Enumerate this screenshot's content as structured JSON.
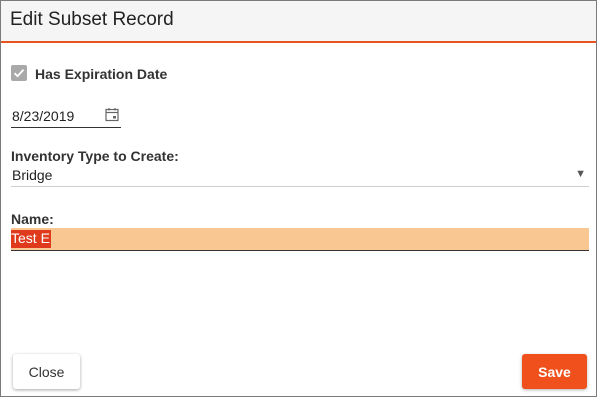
{
  "dialog": {
    "title": "Edit Subset Record"
  },
  "expiration": {
    "checkbox_label": "Has Expiration Date",
    "checked": true,
    "date_value": "8/23/2019"
  },
  "inventory_type": {
    "label": "Inventory Type to Create:",
    "selected": "Bridge"
  },
  "name": {
    "label": "Name:",
    "value": "Test E"
  },
  "buttons": {
    "close_label": "Close",
    "save_label": "Save"
  },
  "icons": {
    "check": "check-icon",
    "calendar": "calendar-icon",
    "dropdown": "dropdown-arrow-icon"
  },
  "colors": {
    "accent": "#e8541f",
    "save_button": "#f0511c",
    "name_field_bg": "#f9c792",
    "selection_highlight": "#e03a1c"
  }
}
